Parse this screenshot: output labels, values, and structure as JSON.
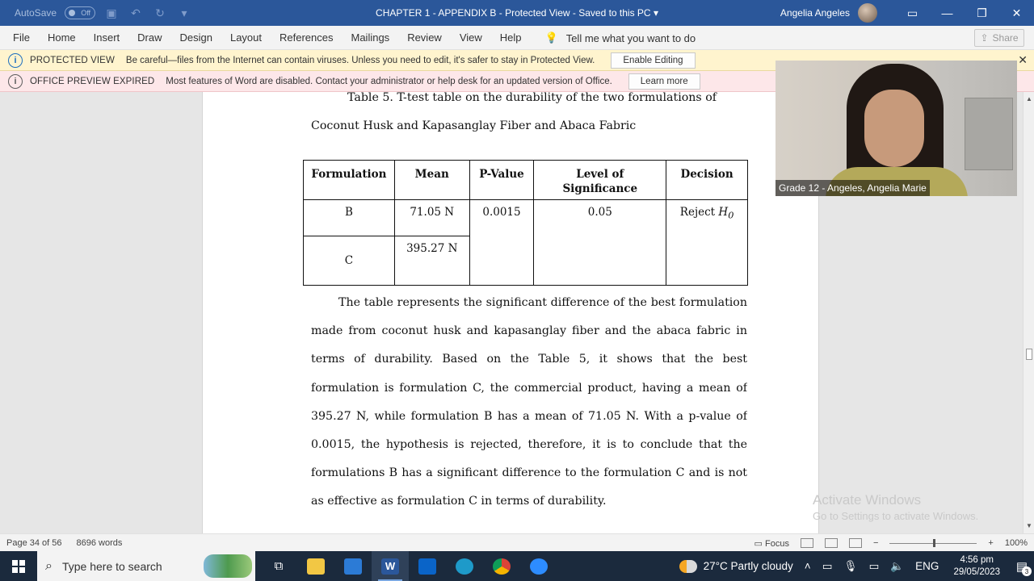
{
  "titlebar": {
    "autosave_label": "AutoSave",
    "autosave_state": "Off",
    "doc_title": "CHAPTER 1 - APPENDIX B  -  Protected View  -  Saved to this PC",
    "user_name": "Angelia Angeles"
  },
  "ribbon": {
    "tabs": [
      "File",
      "Home",
      "Insert",
      "Draw",
      "Design",
      "Layout",
      "References",
      "Mailings",
      "Review",
      "View",
      "Help"
    ],
    "tell_me": "Tell me what you want to do",
    "share": "Share"
  },
  "protected_bar": {
    "title": "PROTECTED VIEW",
    "text": "Be careful—files from the Internet can contain viruses. Unless you need to edit, it's safer to stay in Protected View.",
    "button": "Enable Editing"
  },
  "expired_bar": {
    "title": "OFFICE PREVIEW EXPIRED",
    "text": "Most features of Word are disabled. Contact your administrator or help desk for an updated version of Office.",
    "button": "Learn more"
  },
  "document": {
    "caption_line1": "Table 5. T-test table on the durability of the two formulations of",
    "caption_line2": "Coconut Husk and  Kapasanglay Fiber and Abaca Fabric",
    "table": {
      "headers": [
        "Formulation",
        "Mean",
        "P-Value",
        "Level of Significance",
        "Decision"
      ],
      "row_b": {
        "formulation": "B",
        "mean": "71.05 N",
        "p_value": "0.0015",
        "level": "0.05",
        "decision": "Reject",
        "decision_sym": "H",
        "decision_sub": "0"
      },
      "row_c": {
        "formulation": "C",
        "mean": "395.27 N"
      }
    },
    "paragraph": [
      "The table represents the significant difference of the best formulation",
      "made from coconut husk and kapasanglay fiber and the abaca fabric in",
      "terms of durability. Based on the Table 5, it shows that the best",
      "formulation is formulation C, the commercial product, having a mean of",
      "395.27 N, while formulation B has a mean of 71.05 N. With a p-value of",
      "0.0015, the hypothesis is rejected, therefore, it is to conclude that the",
      "formulations B has a significant difference to the formulation C and is not",
      "as effective as formulation C in terms of durability."
    ]
  },
  "webcam": {
    "participant": "Grade 12 - Angeles, Angelia Marie"
  },
  "watermark": {
    "line1": "Activate Windows",
    "line2": "Go to Settings to activate Windows."
  },
  "statusbar": {
    "page": "Page 34 of 56",
    "words": "8696 words",
    "focus": "Focus",
    "zoom": "100%"
  },
  "taskbar": {
    "search_placeholder": "Type here to search",
    "weather": "27°C  Partly cloudy",
    "lang": "ENG",
    "time": "4:56 pm",
    "date": "29/05/2023",
    "notifications": "3"
  }
}
